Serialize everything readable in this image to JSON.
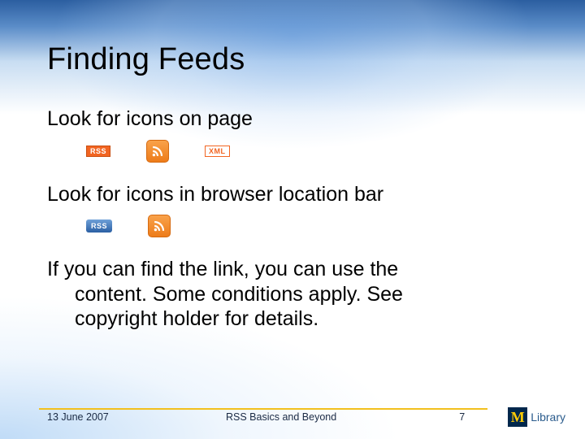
{
  "title": "Finding Feeds",
  "section1": {
    "heading": "Look for icons on page",
    "icons": {
      "rss_badge_label": "RSS",
      "xml_badge_label": "XML"
    }
  },
  "section2": {
    "heading": "Look for icons in browser location bar",
    "icons": {
      "rss_badge_label": "RSS"
    }
  },
  "paragraph": {
    "line1": "If you can find the link, you can use the",
    "line2": "content.  Some conditions apply.  See",
    "line3": "copyright holder for details."
  },
  "footer": {
    "date": "13 June 2007",
    "title": "RSS Basics and Beyond",
    "page": "7",
    "logo": {
      "m": "M",
      "word": "Library"
    }
  }
}
